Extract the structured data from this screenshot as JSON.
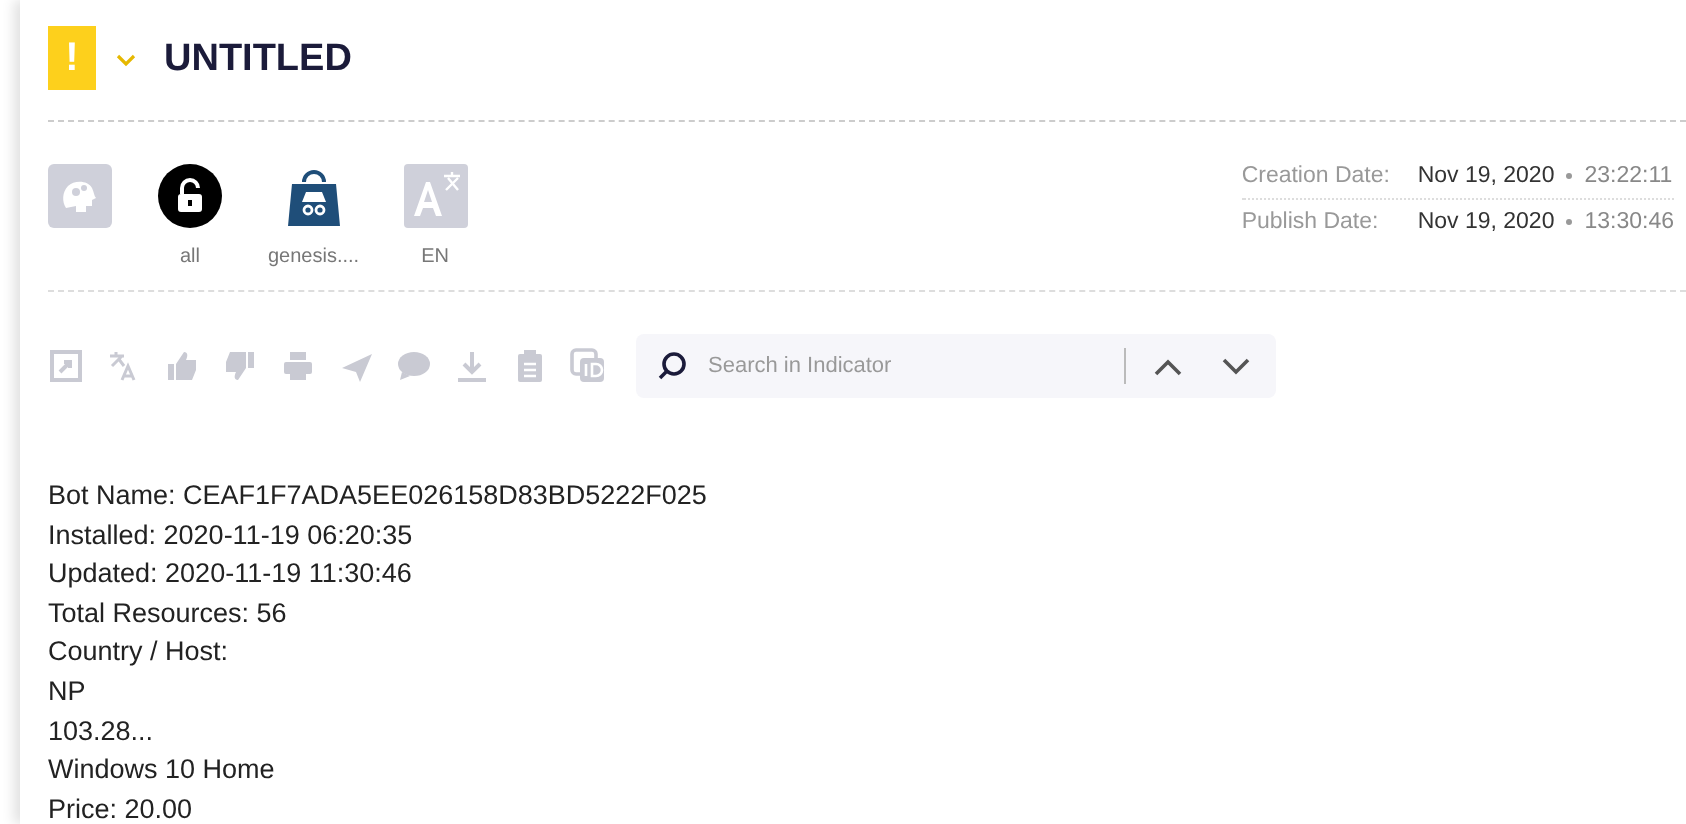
{
  "header": {
    "alert": "!",
    "title": "UNTITLED"
  },
  "badges": [
    {
      "kind": "brain"
    },
    {
      "kind": "lock",
      "label": "all"
    },
    {
      "kind": "bag",
      "label": "genesis...."
    },
    {
      "kind": "translate",
      "label": "EN"
    }
  ],
  "dates": [
    {
      "label": "Creation Date:",
      "date": "Nov 19, 2020",
      "time": "23:22:11"
    },
    {
      "label": "Publish Date:",
      "date": "Nov 19, 2020",
      "time": "13:30:46"
    }
  ],
  "toolbar": {
    "search": {
      "placeholder": "Search in Indicator"
    }
  },
  "details": [
    "Bot Name: CEAF1F7ADA5EE026158D83BD5222F025",
    "Installed: 2020-11-19 06:20:35",
    "Updated: 2020-11-19 11:30:46",
    "Total Resources: 56",
    "Country / Host:",
    "NP",
    "103.28...",
    "Windows 10 Home",
    "Price: 20.00"
  ]
}
